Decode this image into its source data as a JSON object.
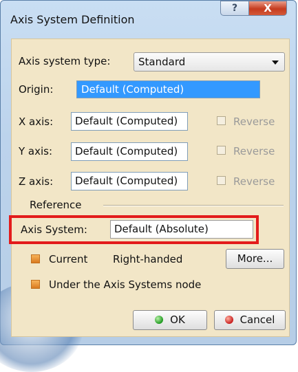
{
  "window": {
    "title": "Axis System Definition",
    "help_glyph": "?",
    "close_glyph": "X"
  },
  "form": {
    "type_label": "Axis system type:",
    "type_value": "Standard",
    "origin_label": "Origin:",
    "origin_value": "Default (Computed)",
    "x_label": "X axis:",
    "x_value": "Default (Computed)",
    "y_label": "Y axis:",
    "y_value": "Default (Computed)",
    "z_label": "Z axis:",
    "z_value": "Default (Computed)",
    "reverse_label": "Reverse",
    "reference_label": "Reference",
    "axis_system_label": "Axis System:",
    "axis_system_value": "Default (Absolute)",
    "current_label": "Current",
    "current_checked": true,
    "handedness": "Right-handed",
    "more_label": "More...",
    "under_node_label": "Under the Axis Systems node",
    "under_node_checked": true
  },
  "buttons": {
    "ok": "OK",
    "cancel": "Cancel"
  },
  "colors": {
    "highlight_box": "#e31b1b",
    "client_bg": "#f2e6c7",
    "selection": "#3399ff"
  }
}
